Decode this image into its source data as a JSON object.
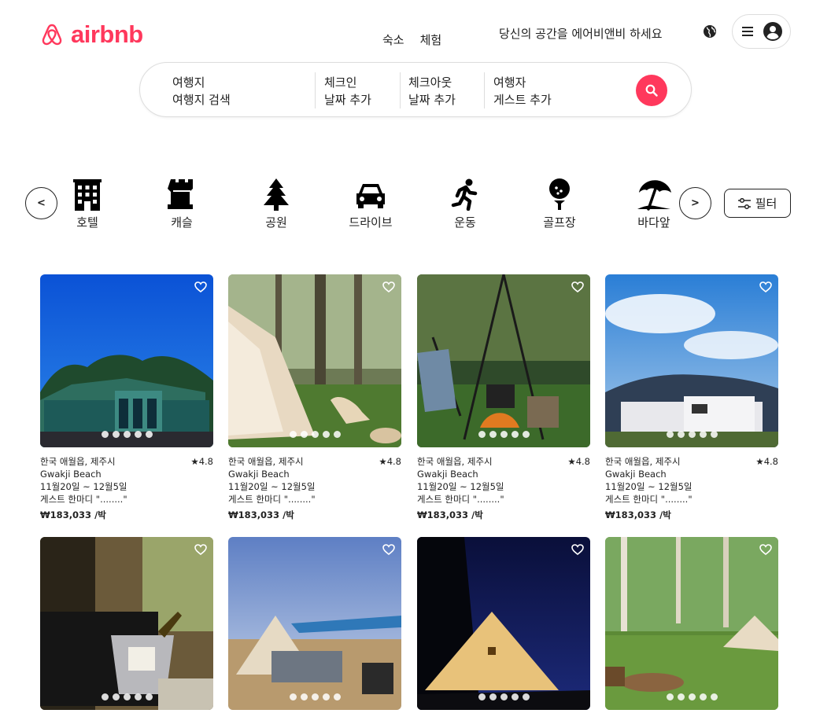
{
  "header": {
    "logo_text": "airbnb",
    "tabs": [
      "숙소",
      "체험"
    ],
    "host_link": "당신의 공간을 에어비앤비 하세요",
    "globe_icon": "globe-icon",
    "menu_icon": "hamburger-menu-icon",
    "avatar_icon": "user-avatar-icon"
  },
  "search": {
    "location_title": "여행지",
    "location_placeholder": "여행지 검색",
    "checkin_title": "체크인",
    "checkin_placeholder": "날짜 추가",
    "checkout_title": "체크아웃",
    "checkout_placeholder": "날짜 추가",
    "guests_title": "여행자",
    "guests_placeholder": "게스트 추가",
    "search_icon": "search-icon"
  },
  "categories": {
    "prev_label": "<",
    "next_label": ">",
    "items": [
      {
        "label": "호텔",
        "icon": "hotel-icon"
      },
      {
        "label": "캐슬",
        "icon": "castle-icon"
      },
      {
        "label": "공원",
        "icon": "tree-icon"
      },
      {
        "label": "드라이브",
        "icon": "car-icon"
      },
      {
        "label": "운동",
        "icon": "running-icon"
      },
      {
        "label": "골프장",
        "icon": "golf-icon"
      },
      {
        "label": "바다앞",
        "icon": "beach-umbrella-icon"
      }
    ],
    "filter_label": "필터",
    "filter_icon": "sliders-icon"
  },
  "listings": [
    {
      "location": "한국 애월읍, 제주시",
      "rating": "★4.8",
      "title": "Gwakji Beach",
      "dates": "11월20일 ~ 12월5일",
      "review": "게스트 한마디 \"........\"",
      "price": "₩183,033 /박"
    },
    {
      "location": "한국 애월읍, 제주시",
      "rating": "★4.8",
      "title": "Gwakji Beach",
      "dates": "11월20일 ~ 12월5일",
      "review": "게스트 한마디 \"........\"",
      "price": "₩183,033 /박"
    },
    {
      "location": "한국 애월읍, 제주시",
      "rating": "★4.8",
      "title": "Gwakji Beach",
      "dates": "11월20일 ~ 12월5일",
      "review": "게스트 한마디 \"........\"",
      "price": "₩183,033 /박"
    },
    {
      "location": "한국 애월읍, 제주시",
      "rating": "★4.8",
      "title": "Gwakji Beach",
      "dates": "11월20일 ~ 12월5일",
      "review": "게스트 한마디 \"........\"",
      "price": "₩183,033 /박"
    }
  ],
  "colors": {
    "brand": "#ff385c",
    "text": "#222222",
    "border": "#dddddd"
  }
}
